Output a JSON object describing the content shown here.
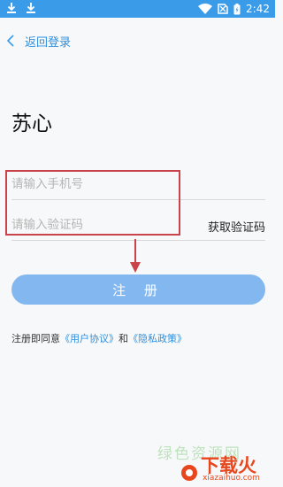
{
  "status_bar": {
    "time": "2:42"
  },
  "nav": {
    "back_label": "返回登录"
  },
  "app_name": "苏心",
  "form": {
    "phone_placeholder": "请输入手机号",
    "code_placeholder": "请输入验证码",
    "get_code_label": "获取验证码",
    "register_label": "注 册"
  },
  "agreement": {
    "prefix": "注册即同意",
    "user_agreement": "《用户协议》",
    "and": "和",
    "privacy_policy": "《隐私政策》"
  },
  "watermark": {
    "text": "绿色资源网",
    "brand": "下载火",
    "domain": "xiazaihuo.com"
  },
  "colors": {
    "accent": "#3a9be8",
    "button": "#82b8ef",
    "annotation": "#c9444a"
  }
}
